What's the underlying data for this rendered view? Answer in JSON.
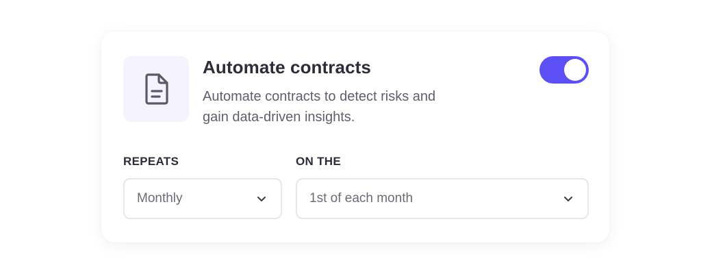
{
  "card": {
    "title": "Automate contracts",
    "description": "Automate contracts to detect risks and gain data-driven insights.",
    "icon": "document-icon",
    "toggle": {
      "enabled": true,
      "color": "#5b4ff5"
    }
  },
  "schedule": {
    "repeats": {
      "label": "REPEATS",
      "value": "Monthly",
      "icon": "chevron-down-icon"
    },
    "on_the": {
      "label": "ON THE",
      "value": "1st of each month",
      "icon": "chevron-down-icon"
    }
  },
  "colors": {
    "accent": "#5b4ff5",
    "icon_bg": "#f4f3fe",
    "text_primary": "#2c2c3a",
    "text_secondary": "#5e5e6e"
  }
}
